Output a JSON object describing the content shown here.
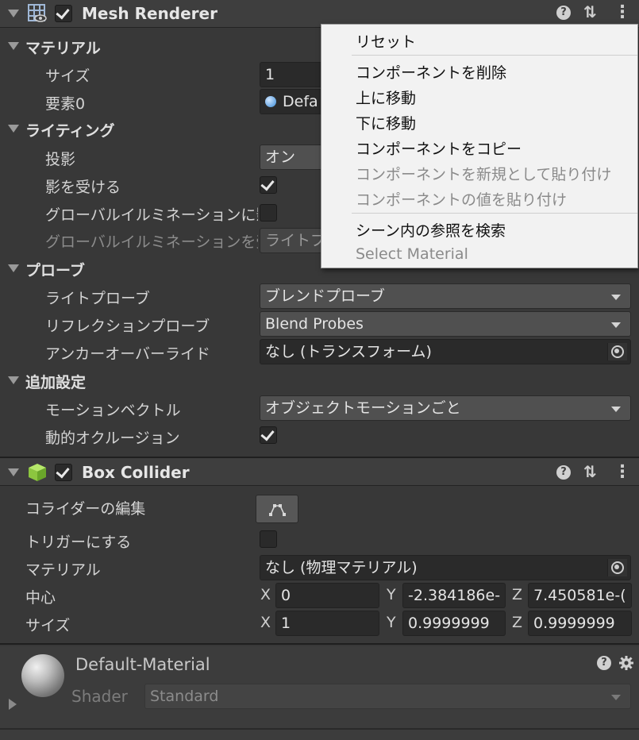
{
  "mesh_renderer": {
    "title": "Mesh Renderer",
    "enabled": true,
    "materials": {
      "section": "マテリアル",
      "size_label": "サイズ",
      "size_value": "1",
      "element_label": "要素0",
      "element_value": "Defa"
    },
    "lighting": {
      "section": "ライティング",
      "cast_shadows_label": "投影",
      "cast_shadows_value": "オン",
      "receive_shadows_label": "影を受ける",
      "receive_shadows_checked": true,
      "contribute_gi_label": "グローバルイルミネーションに影響",
      "contribute_gi_checked": false,
      "receive_gi_label": "グローバルイルミネーションを受け",
      "receive_gi_value": "ライトプロ"
    },
    "probes": {
      "section": "プローブ",
      "light_probes_label": "ライトプローブ",
      "light_probes_value": "ブレンドプローブ",
      "reflection_probes_label": "リフレクションプローブ",
      "reflection_probes_value": "Blend Probes",
      "anchor_override_label": "アンカーオーバーライド",
      "anchor_override_value": "なし (トランスフォーム)"
    },
    "additional": {
      "section": "追加設定",
      "motion_vectors_label": "モーションベクトル",
      "motion_vectors_value": "オブジェクトモーションごと",
      "dynamic_occlusion_label": "動的オクルージョン",
      "dynamic_occlusion_checked": true
    }
  },
  "context_menu": {
    "items": [
      {
        "label": "リセット",
        "enabled": true
      },
      {
        "label": "コンポーネントを削除",
        "enabled": true
      },
      {
        "label": "上に移動",
        "enabled": true
      },
      {
        "label": "下に移動",
        "enabled": true
      },
      {
        "label": "コンポーネントをコピー",
        "enabled": true
      },
      {
        "label": "コンポーネントを新規として貼り付け",
        "enabled": false
      },
      {
        "label": "コンポーネントの値を貼り付け",
        "enabled": false
      },
      {
        "label": "シーン内の参照を検索",
        "enabled": true
      },
      {
        "label": "Select Material",
        "enabled": false
      }
    ]
  },
  "box_collider": {
    "title": "Box Collider",
    "enabled": true,
    "edit_collider_label": "コライダーの編集",
    "is_trigger_label": "トリガーにする",
    "is_trigger_checked": false,
    "material_label": "マテリアル",
    "material_value": "なし (物理マテリアル)",
    "center_label": "中心",
    "center": {
      "x_axis": "X",
      "x": "0",
      "y_axis": "Y",
      "y": "-2.384186e-",
      "z_axis": "Z",
      "z": "7.450581e-("
    },
    "size_label": "サイズ",
    "size": {
      "x_axis": "X",
      "x": "1",
      "y_axis": "Y",
      "y": "0.9999999",
      "z_axis": "Z",
      "z": "0.9999999"
    }
  },
  "material_preview": {
    "name": "Default-Material",
    "shader_label": "Shader",
    "shader_value": "Standard"
  },
  "icons": {
    "help": "?",
    "presets": "⇅",
    "more": "⋮"
  }
}
